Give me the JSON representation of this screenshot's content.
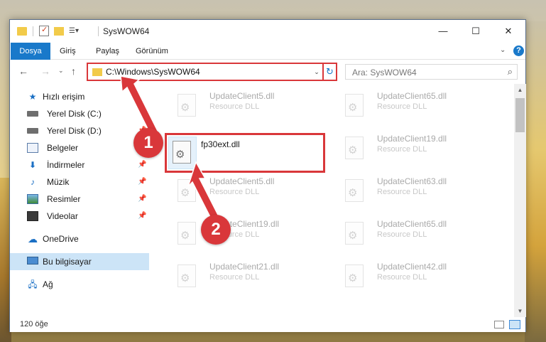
{
  "window": {
    "title": "SysWOW64",
    "controls": {
      "minimize": "—",
      "maximize": "☐",
      "close": "✕"
    }
  },
  "ribbon": {
    "tabs": [
      "Dosya",
      "Giriş",
      "Paylaş",
      "Görünüm"
    ],
    "active_tab": "Dosya",
    "help": "?",
    "collapse": "⌄"
  },
  "address": {
    "path": "C:\\Windows\\SysWOW64",
    "dropdown": "⌄",
    "refresh": "↻"
  },
  "navigation": {
    "back": "←",
    "forward": "→",
    "recent": "⌄",
    "up": "↑"
  },
  "search": {
    "placeholder": "Ara: SysWOW64",
    "icon": "search-icon"
  },
  "sidebar": {
    "items": [
      {
        "label": "Hızlı erişim",
        "icon": "star-icon"
      },
      {
        "label": "Yerel Disk (C:)",
        "icon": "disk-icon"
      },
      {
        "label": "Yerel Disk (D:)",
        "icon": "disk-icon",
        "pinned": true
      },
      {
        "label": "Belgeler",
        "icon": "documents-icon",
        "pinned": true
      },
      {
        "label": "İndirmeler",
        "icon": "downloads-icon",
        "pinned": true
      },
      {
        "label": "Müzik",
        "icon": "music-icon",
        "pinned": true
      },
      {
        "label": "Resimler",
        "icon": "pictures-icon",
        "pinned": true
      },
      {
        "label": "Videolar",
        "icon": "videos-icon",
        "pinned": true
      },
      {
        "label": "OneDrive",
        "icon": "onedrive-icon"
      },
      {
        "label": "Bu bilgisayar",
        "icon": "computer-icon",
        "selected": true
      },
      {
        "label": "Ağ",
        "icon": "network-icon"
      }
    ]
  },
  "files": [
    {
      "name": "UpdateClient5.dll",
      "type": "Resource DLL"
    },
    {
      "name": "UpdateClient65.dll",
      "type": "Resource DLL"
    },
    {
      "name": "UpdateClient19.dll",
      "type": "Resource DLL"
    },
    {
      "name": "UpdateClient5.dll",
      "type": "Resource DLL"
    },
    {
      "name": "UpdateClient63.dll",
      "type": "Resource DLL"
    },
    {
      "name": "UpdateClient19.dll",
      "type": "Resource DLL"
    },
    {
      "name": "UpdateClient65.dll",
      "type": "Resource DLL"
    },
    {
      "name": "UpdateClient21.dll",
      "type": "Resource DLL"
    },
    {
      "name": "UpdateClient42.dll",
      "type": "Resource DLL"
    }
  ],
  "highlighted_file": {
    "name": "fp30ext.dll"
  },
  "status": {
    "item_count": "120 öğe"
  },
  "annotations": {
    "step1": "1",
    "step2": "2",
    "color": "#d9373a"
  }
}
